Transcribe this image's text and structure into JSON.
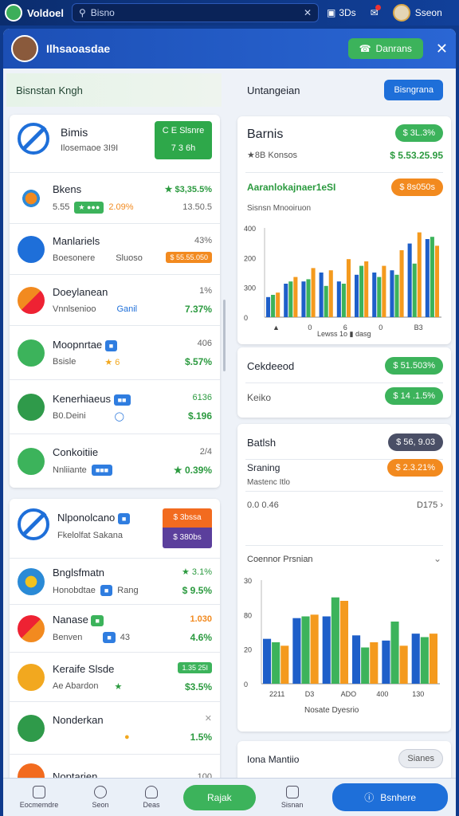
{
  "topbar": {
    "app_name": "Voldoel",
    "search_placeholder": "Bisno",
    "icon_label": "3Ds",
    "user_name": "Sseon"
  },
  "header": {
    "title": "Ilhsaoasdae",
    "action_label": "Danrans"
  },
  "left": {
    "heading": "Bisnstan Kngh",
    "card1": {
      "title": "Bimis",
      "subtitle": "Ilosemaoe 3I9I",
      "tile_top": "C E Slsnre",
      "tile_bottom": "7 3 6h",
      "rows": [
        {
          "title": "Bkens",
          "meta_left": "5.55",
          "tag": "",
          "meta_mid": "2.09%",
          "meta_right": "13.50.5",
          "value": "★ $3,35.5%"
        },
        {
          "title": "Manlariels",
          "meta_left": "Boesonere",
          "tag": "",
          "meta_mid": "Sluoso",
          "meta_right": "43%",
          "value": "$ 55.55.050"
        },
        {
          "title": "Doeylanean",
          "meta_left": "Vnnlsenioo",
          "tag": "",
          "meta_mid": "Ganil",
          "meta_right": "1%",
          "value": "7.37%"
        },
        {
          "title": "Moopnrtae",
          "meta_left": "Bsisle",
          "tag": "",
          "meta_mid": "★ 6",
          "meta_right": "406",
          "value": "$.57%"
        },
        {
          "title": "Kenerhiaeus",
          "meta_left": "B0.Deini",
          "tag": "",
          "meta_mid": "",
          "meta_right": "6136",
          "value": "$.196"
        },
        {
          "title": "Conkoitiie",
          "meta_left": "Nnliiante",
          "tag": "",
          "meta_mid": "",
          "meta_right": "2/4",
          "value": "★ 0.39%"
        }
      ]
    },
    "card2": {
      "title": "Nlponolcano",
      "subtitle": "Fkelolfat Sakana",
      "badge_top": "$ 3bssa",
      "badge_bottom": "$ 380bs",
      "rows": [
        {
          "title": "Bnglsfmatn",
          "meta_left": "Honobdtae",
          "meta_mid": "Rang",
          "meta_right": "★ 3.1%",
          "value": "$ 9.5%"
        },
        {
          "title": "Nanase",
          "meta_left": "Benven",
          "meta_mid": "43",
          "meta_right": "1.030",
          "value": "4.6%"
        },
        {
          "title": "Keraife Slsde",
          "meta_left": "Ae Abardon",
          "meta_mid": "",
          "meta_right": "1.35 25I",
          "value": "$3.5%"
        },
        {
          "title": "Nonderkan",
          "meta_left": "",
          "meta_mid": "",
          "meta_right": "",
          "value": "1.5%"
        },
        {
          "title": "Noptarjen",
          "meta_left": "",
          "meta_mid": "",
          "meta_right": "100",
          "value": ""
        }
      ]
    }
  },
  "right": {
    "heading": "Untangeian",
    "action_label": "Bisngrana",
    "card1": {
      "title": "Barnis",
      "sub_left": "★8B Konsos",
      "pill1": "$ 3L.3%",
      "pill2": "$ 5.53.25.95",
      "section_title": "Aaranlokajnaer1eSI",
      "section_pill": "$ 8s050s",
      "chart_label": "Sisnsn Mnooiruon",
      "chart_caption": "Lewss 1o ▮ dasg"
    },
    "card2": {
      "title": "Cekdeeod",
      "pill1": "$ 51.503%",
      "sub": "Keiko",
      "pill2": "$ 14 .1.5%"
    },
    "card3": {
      "title": "Batlsh",
      "pill1": "$ 56, 9.03",
      "sub_title": "Sraning",
      "pill2": "$ 2.3.21%",
      "sub": "Mastenc Itlo",
      "stat_left": "0.0 0.46",
      "stat_right": "D175",
      "chart_title": "Coennor Prsnian",
      "chart_caption": "Nosate Dyesrio"
    },
    "card4": {
      "title": "Iona Mantiio",
      "pill": "Sianes"
    }
  },
  "chart_data": [
    {
      "type": "bar",
      "title": "",
      "xlabel": "",
      "ylabel": "",
      "ylim": [
        0,
        400
      ],
      "yticks": [
        "400",
        "200",
        "300",
        "0"
      ],
      "xticks": [
        "▲",
        "0",
        "6",
        "0",
        "B3"
      ],
      "series": [
        {
          "values": [
            90,
            150,
            160,
            200,
            160,
            190,
            200,
            210,
            330,
            350
          ]
        },
        {
          "values": [
            100,
            160,
            170,
            140,
            150,
            230,
            180,
            190,
            240,
            360
          ]
        },
        {
          "values": [
            110,
            180,
            220,
            210,
            260,
            250,
            230,
            300,
            380,
            320
          ]
        }
      ]
    },
    {
      "type": "bar",
      "title": "",
      "xlabel": "",
      "ylabel": "",
      "ylim": [
        0,
        60
      ],
      "yticks": [
        "30",
        "80",
        "20",
        "0"
      ],
      "xticks": [
        "2211",
        "D3",
        "ADO",
        "400",
        "130"
      ],
      "series": [
        {
          "values": [
            26,
            38,
            39,
            28,
            25,
            29
          ]
        },
        {
          "values": [
            24,
            39,
            50,
            21,
            36,
            27
          ]
        },
        {
          "values": [
            22,
            40,
            48,
            24,
            22,
            29
          ]
        }
      ]
    }
  ],
  "colors": {
    "blue": "#1e5fc9",
    "green": "#3cb35b",
    "orange": "#f49a1e",
    "grey": "#c9ced8"
  },
  "bottom": {
    "nav": [
      {
        "label": "Eocmemdre"
      },
      {
        "label": "Seon"
      },
      {
        "label": "Deas"
      }
    ],
    "green_label": "Rajak",
    "blue_label": "Bsnhere",
    "right_label": "Sisnan"
  }
}
